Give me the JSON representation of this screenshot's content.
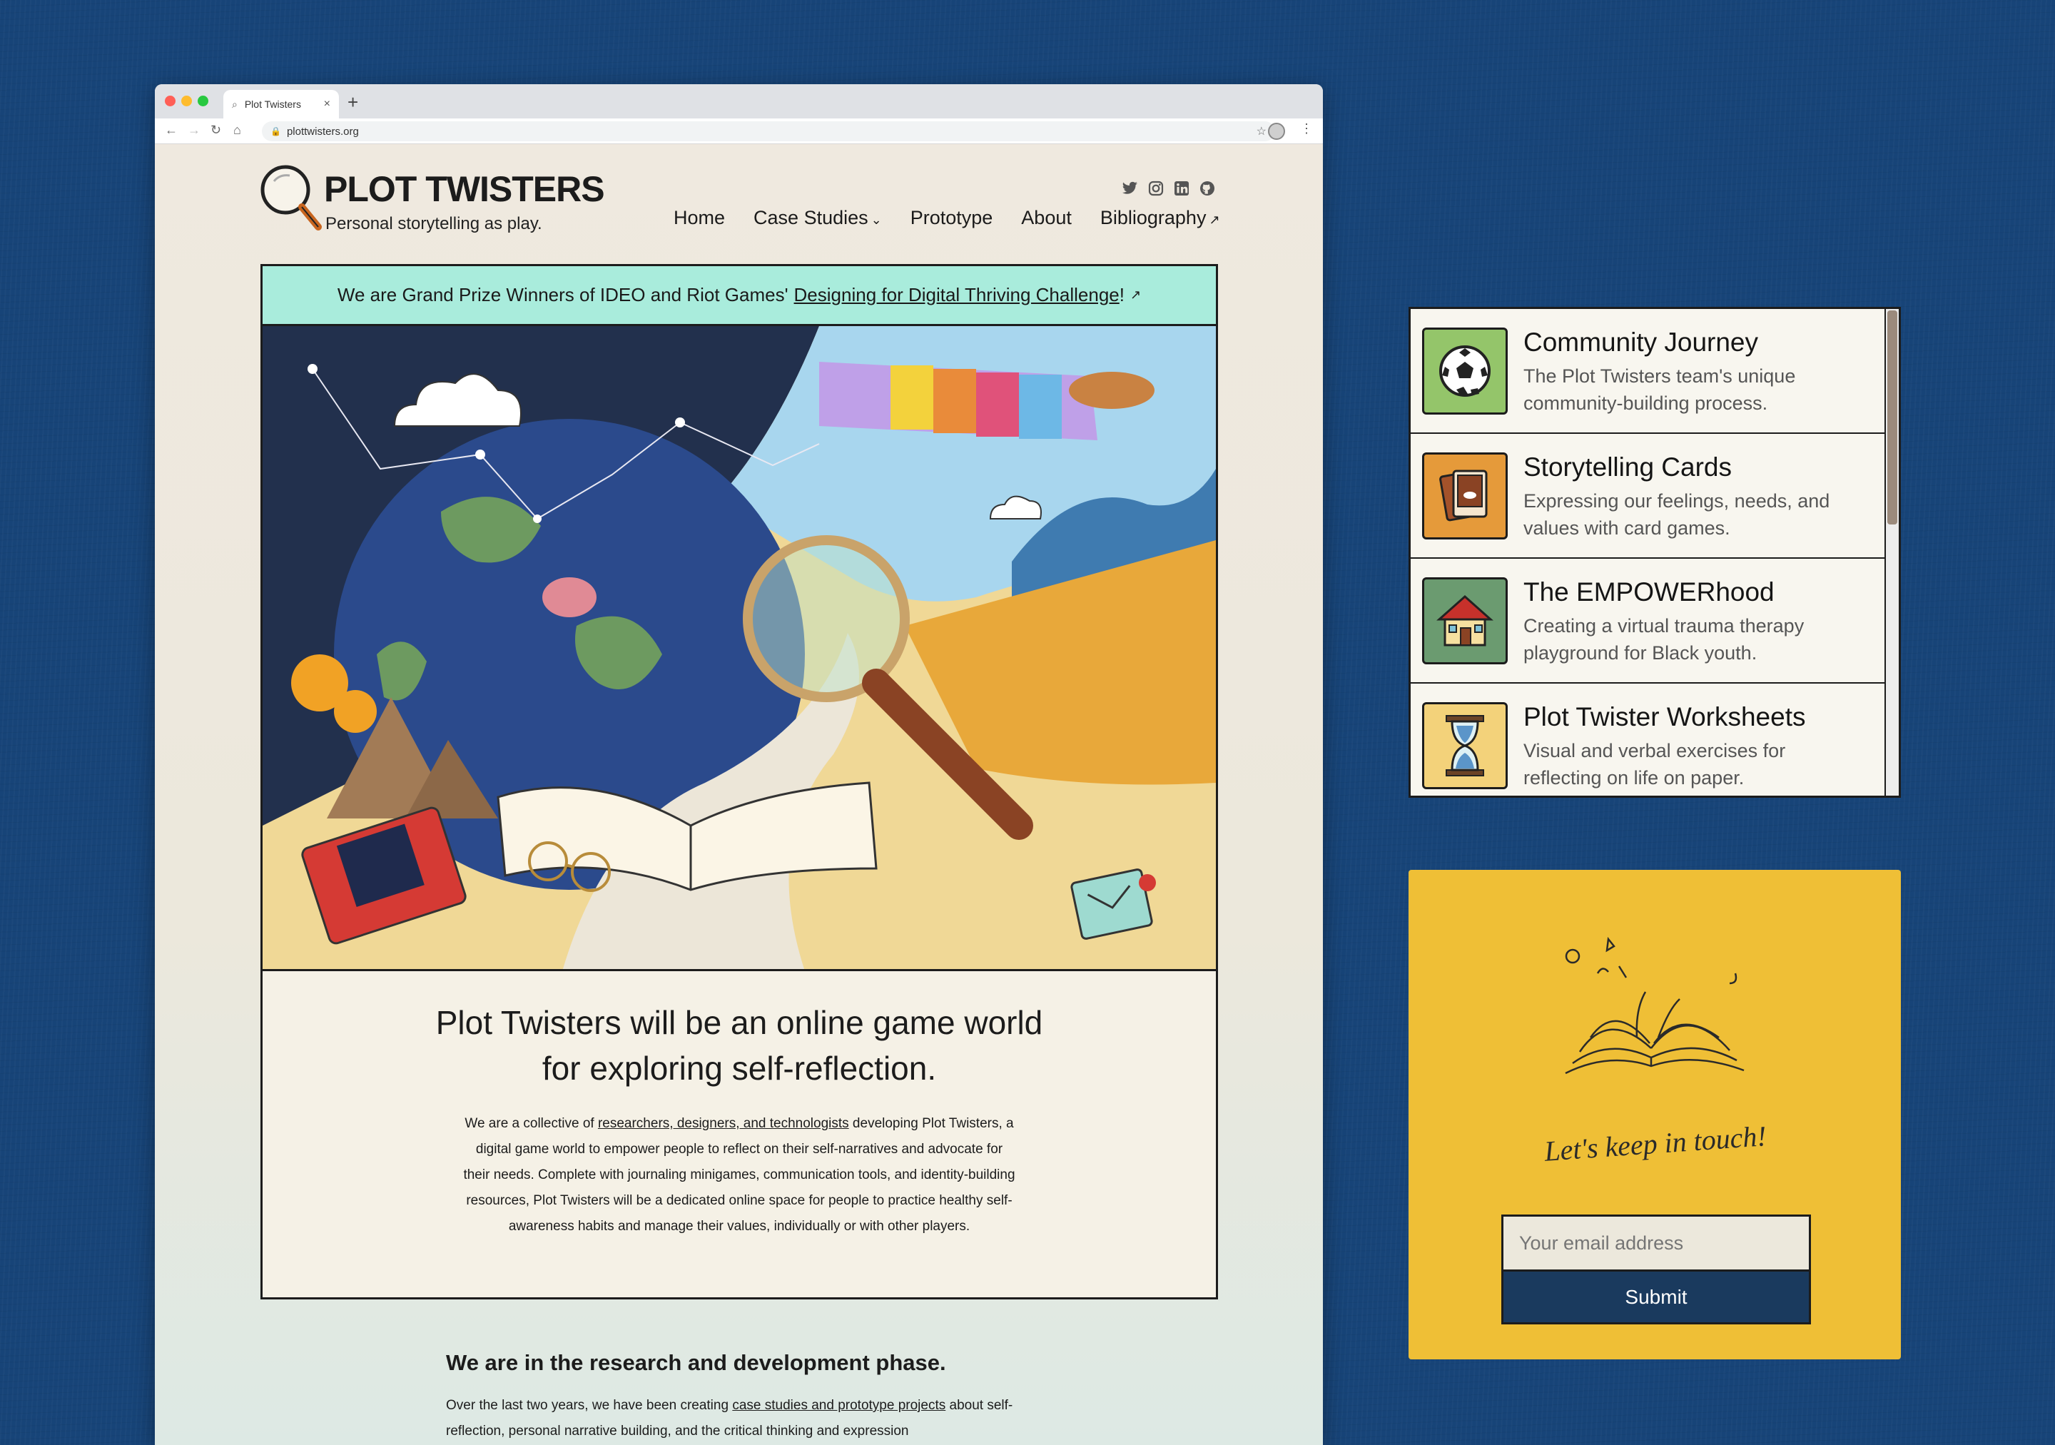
{
  "browser": {
    "tab_title": "Plot Twisters",
    "url": "plottwisters.org"
  },
  "site": {
    "name": "PLOT TWISTERS",
    "tagline": "Personal storytelling as play.",
    "nav": {
      "home": "Home",
      "case_studies": "Case Studies",
      "prototype": "Prototype",
      "about": "About",
      "bibliography": "Bibliography"
    },
    "social_icons": [
      "twitter-icon",
      "instagram-icon",
      "linkedin-icon",
      "github-icon"
    ]
  },
  "banner": {
    "text": "We are Grand Prize Winners of IDEO and Riot Games'",
    "link": "Designing for Digital Thriving Challenge",
    "suffix": "!"
  },
  "intro": {
    "headline_line1": "Plot Twisters will be an online game world",
    "headline_line2": "for exploring self-reflection.",
    "body_before": "We are a collective of ",
    "body_link": "researchers, designers, and technologists",
    "body_after": " developing Plot Twisters, a digital game world to empower people to reflect on their self-narratives and advocate for their needs. Complete with journaling minigames, communication tools, and identity-building resources, Plot Twisters will be a dedicated online space for people to practice healthy self-awareness habits and manage their values, individually or with other players."
  },
  "research": {
    "title": "We are in the research and development phase.",
    "text_before": "Over the last two years, we have been creating ",
    "text_link": "case studies and prototype projects",
    "text_after": " about self-reflection, personal narrative building, and the critical thinking and expression"
  },
  "projects": [
    {
      "title": "Community Journey",
      "desc1": "The Plot Twisters team's unique",
      "desc2": "community-building process.",
      "icon": "soccer-ball-icon",
      "color": "#94c56a"
    },
    {
      "title": "Storytelling Cards",
      "desc1": "Expressing our feelings, needs, and",
      "desc2": "values with card games.",
      "icon": "cards-icon",
      "color": "#e59a3a"
    },
    {
      "title": "The EMPOWERhood",
      "desc1": "Creating a virtual trauma therapy",
      "desc2": "playground for Black youth.",
      "icon": "house-icon",
      "color": "#6b9b70"
    },
    {
      "title": "Plot Twister Worksheets",
      "desc1": "Visual and verbal exercises for",
      "desc2": "reflecting on life on paper.",
      "icon": "hourglass-icon",
      "color": "#f3d27a"
    }
  ],
  "newsletter": {
    "tagline": "Let's keep in touch!",
    "email_placeholder": "Your email address",
    "submit": "Submit"
  }
}
